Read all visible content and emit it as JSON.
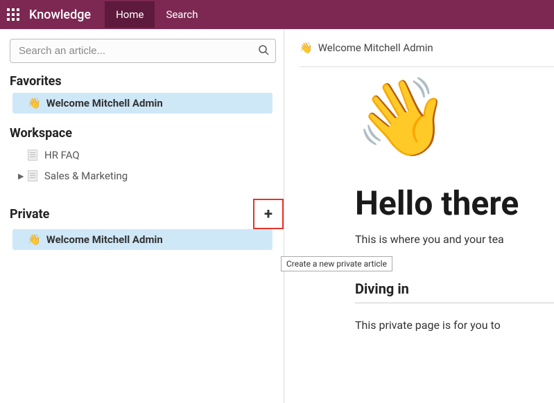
{
  "topbar": {
    "brand": "Knowledge",
    "nav": {
      "home": "Home",
      "search": "Search"
    }
  },
  "sidebar": {
    "search_placeholder": "Search an article...",
    "sections": {
      "favorites": {
        "title": "Favorites",
        "items": [
          {
            "emoji": "👋",
            "label": "Welcome Mitchell Admin",
            "selected": true
          }
        ]
      },
      "workspace": {
        "title": "Workspace",
        "items": [
          {
            "icon": "doc",
            "label": "HR FAQ",
            "expandable": false
          },
          {
            "icon": "doc",
            "label": "Sales & Marketing",
            "expandable": true
          }
        ]
      },
      "private": {
        "title": "Private",
        "add_tooltip": "Create a new private article",
        "items": [
          {
            "emoji": "👋",
            "label": "Welcome Mitchell Admin",
            "selected": true
          }
        ]
      }
    }
  },
  "article": {
    "breadcrumb_emoji": "👋",
    "breadcrumb": "Welcome Mitchell Admin",
    "hero_emoji": "👋",
    "title": "Hello there",
    "intro": "This is where you and your tea",
    "section1_title": "Diving in",
    "section1_body": "This private page is for you to"
  }
}
